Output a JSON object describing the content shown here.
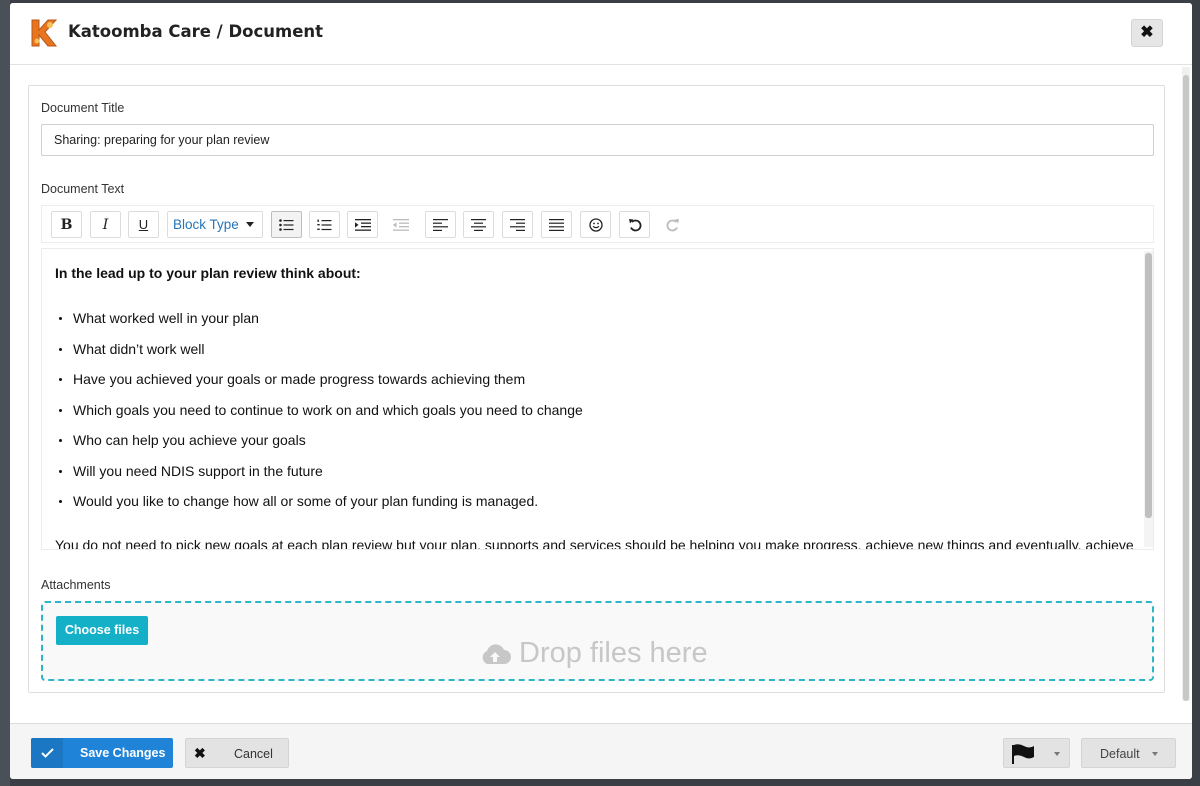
{
  "header": {
    "title": "Katoomba Care / Document",
    "logo_letter": "K",
    "close_icon": "close-icon"
  },
  "form": {
    "title_label": "Document Title",
    "title_value": "Sharing: preparing for your plan review",
    "text_label": "Document Text",
    "attachments_label": "Attachments"
  },
  "toolbar": {
    "bold": "B",
    "italic": "I",
    "underline": "U",
    "block_type": "Block Type",
    "icons": [
      "bold-icon",
      "italic-icon",
      "underline-icon",
      "unordered-list-icon",
      "ordered-list-icon",
      "indent-icon",
      "outdent-icon",
      "align-left-icon",
      "align-center-icon",
      "align-right-icon",
      "align-justify-icon",
      "emoji-icon",
      "undo-icon",
      "redo-icon"
    ]
  },
  "editor": {
    "heading": "In the lead up to your plan review think about:",
    "items": [
      "What worked well in your plan",
      "What didn’t work well",
      "Have you achieved your goals or made progress towards achieving them",
      "Which goals you need to continue to work on and which goals you need to change",
      "Who can help you achieve your goals",
      "Will you need NDIS support in the future",
      "Would you like to change how all or some of your plan funding is managed."
    ],
    "paragraph": "You do not need to pick new goals at each plan review but your plan, supports and services should be helping you make progress, achieve new things and eventually, achieve"
  },
  "dropzone": {
    "choose_label": "Choose files",
    "drop_label": "Drop files here"
  },
  "footer": {
    "save_label": "Save Changes",
    "cancel_label": "Cancel",
    "default_label": "Default"
  },
  "colors": {
    "primary": "#1f84d8",
    "accent": "#14b0c8",
    "link": "#2874b8",
    "logo": "#e8741e"
  }
}
